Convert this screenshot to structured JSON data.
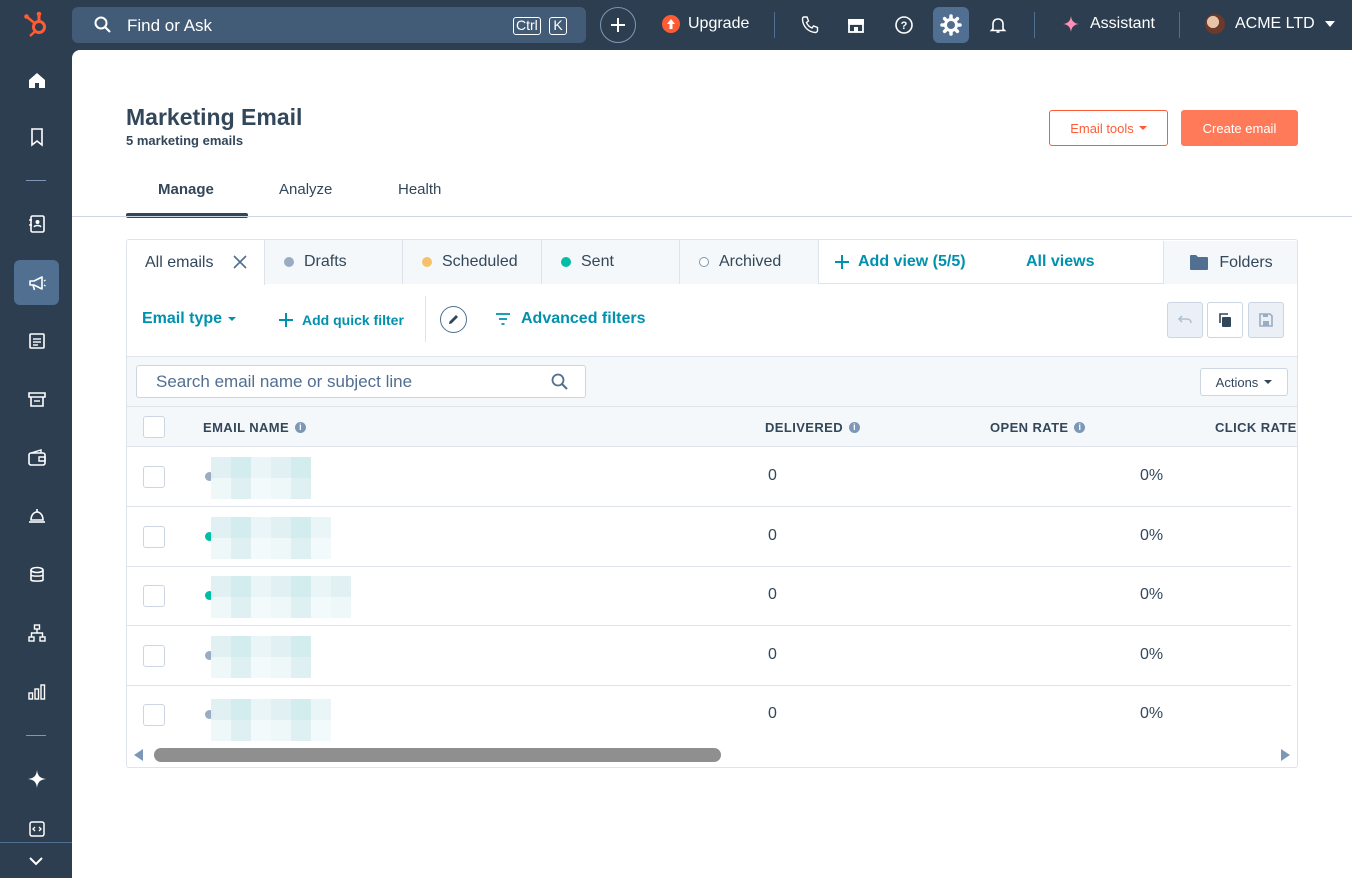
{
  "topbar": {
    "search_text": "Find or Ask",
    "kbd_ctrl": "Ctrl",
    "kbd_k": "K",
    "upgrade_label": "Upgrade",
    "assistant_label": "Assistant",
    "account_name": "ACME LTD",
    "brand_color": "#ff5c35"
  },
  "page": {
    "title": "Marketing Email",
    "subtitle": "5 marketing emails",
    "email_tools_label": "Email tools",
    "create_email_label": "Create email",
    "tabs": [
      {
        "label": "Manage",
        "active": true
      },
      {
        "label": "Analyze",
        "active": false
      },
      {
        "label": "Health",
        "active": false
      }
    ]
  },
  "views": {
    "tabs": [
      {
        "label": "All emails",
        "dot": ""
      },
      {
        "label": "Drafts",
        "dot": "#99acc2"
      },
      {
        "label": "Scheduled",
        "dot": "#f5c26b"
      },
      {
        "label": "Sent",
        "dot": "#00bda5"
      },
      {
        "label": "Archived",
        "dot": "outline"
      }
    ],
    "add_view_label": "Add view (5/5)",
    "all_views_label": "All views",
    "folders_label": "Folders"
  },
  "filters": {
    "email_type_label": "Email type",
    "add_quick_filter_label": "Add quick filter",
    "advanced_filters_label": "Advanced filters"
  },
  "toolbar": {
    "search_placeholder": "Search email name or subject line",
    "actions_label": "Actions"
  },
  "table": {
    "columns": [
      "EMAIL NAME",
      "DELIVERED",
      "OPEN RATE",
      "CLICK RATE"
    ],
    "rows": [
      {
        "status_color": "#99acc2",
        "delivered": "0",
        "open_rate": "0%"
      },
      {
        "status_color": "#00bda5",
        "delivered": "0",
        "open_rate": "0%"
      },
      {
        "status_color": "#00bda5",
        "delivered": "0",
        "open_rate": "0%"
      },
      {
        "status_color": "#99acc2",
        "delivered": "0",
        "open_rate": "0%"
      },
      {
        "status_color": "#99acc2",
        "delivered": "0",
        "open_rate": "0%"
      }
    ]
  },
  "icons": [
    "hubspot-logo-icon",
    "search-icon",
    "plus-icon",
    "upgrade-arrow-icon",
    "phone-icon",
    "marketplace-icon",
    "help-icon",
    "gear-icon",
    "bell-icon",
    "sparkle-icon",
    "caret-down-icon",
    "home-icon",
    "bookmark-icon",
    "contacts-icon",
    "megaphone-icon",
    "content-icon",
    "commerce-icon",
    "wallet-icon",
    "service-bell-icon",
    "database-icon",
    "hierarchy-icon",
    "reports-icon",
    "ai-sparkle-icon",
    "code-icon",
    "chevron-down-icon",
    "close-icon",
    "folder-icon",
    "pencil-icon",
    "filter-lines-icon",
    "undo-icon",
    "copy-icon",
    "save-icon",
    "info-icon"
  ]
}
